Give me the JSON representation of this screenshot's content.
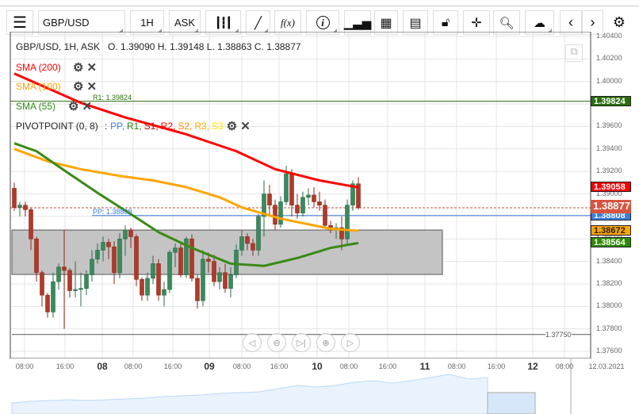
{
  "toolbar": {
    "menu_icon": "hamburger-icon",
    "symbol": "GBP/USD",
    "interval": "1H",
    "price_type": "ASK",
    "fx_label": "f(x)",
    "info_label": "i"
  },
  "header": {
    "instrument": "GBP/USD, 1H, ASK",
    "ohlc": "O. 1.39090 H. 1.39148 L. 1.38863 C. 1.38877"
  },
  "indicators": [
    {
      "label": "SMA (200)",
      "color": "#ff0000"
    },
    {
      "label": "SMA (100)",
      "color": "#ffa500"
    },
    {
      "label": "SMA (55)",
      "color": "#2e8b12"
    }
  ],
  "pivot": {
    "label": "PIVOTPOINT (0, 8)",
    "sep": ":",
    "items": [
      {
        "t": "PP,",
        "c": "#3b7ddd"
      },
      {
        "t": "R1,",
        "c": "#2e7d12"
      },
      {
        "t": "S1,",
        "c": "#c00000"
      },
      {
        "t": "R2,",
        "c": "#ff0000"
      },
      {
        "t": "S2,",
        "c": "#ff8c00"
      },
      {
        "t": "R3,",
        "c": "#ffb000"
      },
      {
        "t": "S3",
        "c": "#ffe000"
      }
    ]
  },
  "lines": {
    "r1_label": "R1: 1.39824",
    "pp_label": "PP: 1.38808",
    "low_label": "1.37750"
  },
  "price_axis": [
    "1.40400",
    "1.40200",
    "1.40000",
    "1.39800",
    "1.39600",
    "1.39400",
    "1.39200",
    "1.39000",
    "1.38800",
    "1.38600",
    "1.38400",
    "1.38200",
    "1.38000",
    "1.37800",
    "1.37600"
  ],
  "price_tags": [
    {
      "value": "1.39824",
      "color": "#2a6e0e"
    },
    {
      "value": "1.39058",
      "color": "#ff0000"
    },
    {
      "value": "1.38808",
      "color": "#3b7ddd"
    },
    {
      "value": "1.38877",
      "color": "#d9533f"
    },
    {
      "value": "1.38672",
      "color": "#ffa500"
    },
    {
      "value": "1.38564",
      "color": "#2e8b00"
    }
  ],
  "time_axis": [
    {
      "t": "08:00",
      "bold": false
    },
    {
      "t": "16:00",
      "bold": false
    },
    {
      "t": "08",
      "bold": true
    },
    {
      "t": "08:00",
      "bold": false
    },
    {
      "t": "16:00",
      "bold": false
    },
    {
      "t": "09",
      "bold": true
    },
    {
      "t": "08:00",
      "bold": false
    },
    {
      "t": "16:00",
      "bold": false
    },
    {
      "t": "10",
      "bold": true
    },
    {
      "t": "08:00",
      "bold": false
    },
    {
      "t": "16:00",
      "bold": false
    },
    {
      "t": "11",
      "bold": true
    },
    {
      "t": "08:00",
      "bold": false
    },
    {
      "t": "16:00",
      "bold": false
    },
    {
      "t": "12",
      "bold": true
    },
    {
      "t": "08:00",
      "bold": false
    },
    {
      "t": "12.03.2021",
      "bold": false
    }
  ],
  "chart_data": {
    "type": "candlestick",
    "ylim": [
      1.376,
      1.404
    ],
    "r1": 1.39824,
    "pp": 1.38808,
    "current": 1.38877,
    "low_marker": 1.3775,
    "zone": [
      1.38284,
      1.38679
    ],
    "candles": [
      [
        1.3905,
        1.391,
        1.3885,
        1.3888
      ],
      [
        1.3888,
        1.3893,
        1.388,
        1.389
      ],
      [
        1.389,
        1.3893,
        1.388,
        1.3886
      ],
      [
        1.3886,
        1.3888,
        1.385,
        1.386
      ],
      [
        1.386,
        1.3862,
        1.3822,
        1.383
      ],
      [
        1.383,
        1.3832,
        1.38,
        1.381
      ],
      [
        1.381,
        1.3812,
        1.379,
        1.3795
      ],
      [
        1.3795,
        1.383,
        1.379,
        1.3822
      ],
      [
        1.3822,
        1.3838,
        1.3815,
        1.3835
      ],
      [
        1.3835,
        1.3868,
        1.378,
        1.3832
      ],
      [
        1.3832,
        1.3834,
        1.3808,
        1.3814
      ],
      [
        1.3814,
        1.384,
        1.3808,
        1.3815
      ],
      [
        1.3815,
        1.383,
        1.38,
        1.3816
      ],
      [
        1.3816,
        1.3832,
        1.381,
        1.3828
      ],
      [
        1.3828,
        1.385,
        1.3822,
        1.3842
      ],
      [
        1.3842,
        1.3856,
        1.3838,
        1.385
      ],
      [
        1.385,
        1.3862,
        1.384,
        1.3857
      ],
      [
        1.3857,
        1.386,
        1.3842,
        1.3853
      ],
      [
        1.3853,
        1.3858,
        1.382,
        1.383
      ],
      [
        1.383,
        1.3865,
        1.3825,
        1.386
      ],
      [
        1.386,
        1.3872,
        1.3845,
        1.3868
      ],
      [
        1.3868,
        1.387,
        1.3852,
        1.3862
      ],
      [
        1.3862,
        1.3864,
        1.3818,
        1.3824
      ],
      [
        1.3824,
        1.3826,
        1.3805,
        1.381
      ],
      [
        1.381,
        1.383,
        1.3805,
        1.3825
      ],
      [
        1.3825,
        1.3845,
        1.382,
        1.3838
      ],
      [
        1.3838,
        1.3842,
        1.3805,
        1.381
      ],
      [
        1.381,
        1.3822,
        1.38,
        1.3815
      ],
      [
        1.3815,
        1.385,
        1.3812,
        1.3848
      ],
      [
        1.3848,
        1.3856,
        1.3835,
        1.3852
      ],
      [
        1.3852,
        1.3858,
        1.3826,
        1.3828
      ],
      [
        1.3828,
        1.3862,
        1.3825,
        1.386
      ],
      [
        1.386,
        1.3864,
        1.3822,
        1.3825
      ],
      [
        1.3825,
        1.3828,
        1.3798,
        1.3805
      ],
      [
        1.3805,
        1.385,
        1.38,
        1.3842
      ],
      [
        1.3842,
        1.3848,
        1.383,
        1.384
      ],
      [
        1.384,
        1.3846,
        1.3818,
        1.3822
      ],
      [
        1.3822,
        1.3835,
        1.3815,
        1.383
      ],
      [
        1.383,
        1.3838,
        1.3812,
        1.3816
      ],
      [
        1.3816,
        1.3835,
        1.3808,
        1.3828
      ],
      [
        1.3828,
        1.3855,
        1.3825,
        1.385
      ],
      [
        1.385,
        1.3868,
        1.3845,
        1.3862
      ],
      [
        1.3862,
        1.3865,
        1.385,
        1.3856
      ],
      [
        1.3856,
        1.386,
        1.3845,
        1.385
      ],
      [
        1.385,
        1.3882,
        1.3845,
        1.388
      ],
      [
        1.388,
        1.3912,
        1.3862,
        1.39
      ],
      [
        1.39,
        1.3908,
        1.388,
        1.389
      ],
      [
        1.389,
        1.3895,
        1.3868,
        1.3873
      ],
      [
        1.3873,
        1.3898,
        1.387,
        1.3893
      ],
      [
        1.3893,
        1.3925,
        1.389,
        1.3918
      ],
      [
        1.3918,
        1.3922,
        1.388,
        1.389
      ],
      [
        1.389,
        1.39,
        1.3878,
        1.3883
      ],
      [
        1.3883,
        1.3902,
        1.388,
        1.3897
      ],
      [
        1.3897,
        1.3905,
        1.389,
        1.3899
      ],
      [
        1.3899,
        1.3906,
        1.3888,
        1.3893
      ],
      [
        1.3893,
        1.3902,
        1.3885,
        1.389
      ],
      [
        1.389,
        1.3895,
        1.387,
        1.3872
      ],
      [
        1.3872,
        1.3876,
        1.3865,
        1.3868
      ],
      [
        1.3868,
        1.3874,
        1.386,
        1.387
      ],
      [
        1.387,
        1.388,
        1.385,
        1.386
      ],
      [
        1.386,
        1.3895,
        1.3855,
        1.389
      ],
      [
        1.389,
        1.3912,
        1.3885,
        1.3909
      ],
      [
        1.3909,
        1.3915,
        1.3886,
        1.38877
      ]
    ],
    "sma": [
      {
        "name": "SMA (200)",
        "color": "#ff0000",
        "points": [
          [
            0,
            1.4007
          ],
          [
            12,
            1.3981
          ],
          [
            20,
            1.3968
          ],
          [
            31,
            1.3953
          ],
          [
            40,
            1.3938
          ],
          [
            47,
            1.3922
          ],
          [
            55,
            1.3912
          ],
          [
            62,
            1.39058
          ]
        ]
      },
      {
        "name": "SMA (100)",
        "color": "#ffa500",
        "points": [
          [
            0,
            1.394
          ],
          [
            6,
            1.3929
          ],
          [
            12,
            1.3922
          ],
          [
            19,
            1.3916
          ],
          [
            25,
            1.3912
          ],
          [
            31,
            1.3906
          ],
          [
            37,
            1.3897
          ],
          [
            41,
            1.3888
          ],
          [
            48,
            1.3878
          ],
          [
            57,
            1.3869
          ],
          [
            62,
            1.38672
          ]
        ]
      },
      {
        "name": "SMA (55)",
        "color": "#3a8a14",
        "points": [
          [
            0,
            1.3945
          ],
          [
            4,
            1.3938
          ],
          [
            9,
            1.3921
          ],
          [
            15,
            1.3901
          ],
          [
            21,
            1.3882
          ],
          [
            26,
            1.3866
          ],
          [
            32,
            1.3852
          ],
          [
            39,
            1.3838
          ],
          [
            45,
            1.3836
          ],
          [
            51,
            1.3843
          ],
          [
            57,
            1.3852
          ],
          [
            62,
            1.38564
          ]
        ]
      }
    ]
  }
}
